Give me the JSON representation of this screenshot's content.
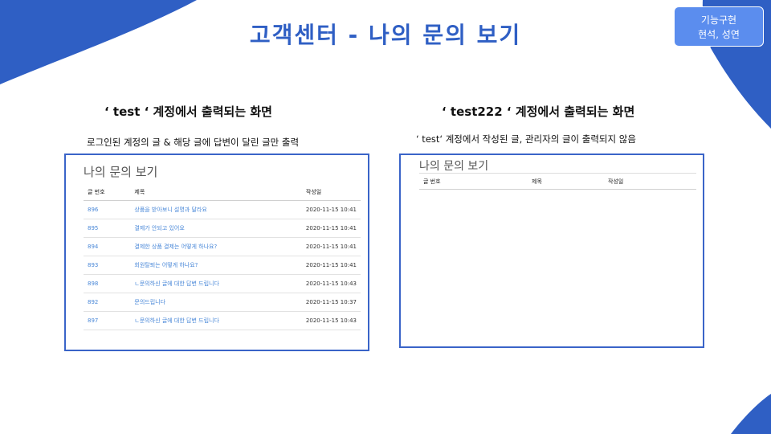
{
  "slide": {
    "title": "고객센터 - 나의 문의 보기",
    "badge": {
      "line1": "기능구현",
      "line2": "현석, 성연"
    },
    "colors": {
      "accent": "#2f5fc4",
      "badge_bg": "#5b8dee",
      "link": "#4a88d8"
    }
  },
  "left": {
    "heading": "‘ test ‘ 계정에서 출력되는 화면",
    "description": "로그인된 계정의 글 &  해당 글에 답변이 달린 글만 출력",
    "panel_title": "나의 문의 보기",
    "columns": [
      "글 번호",
      "제목",
      "작성일"
    ],
    "rows": [
      {
        "no": "896",
        "title": "상품을 받아보니 설명과 달라요",
        "date": "2020-11-15 10:41"
      },
      {
        "no": "895",
        "title": "결제가 안되고 있어요",
        "date": "2020-11-15 10:41"
      },
      {
        "no": "894",
        "title": "결제한 상품 결제는 어떻게 하나요?",
        "date": "2020-11-15 10:41"
      },
      {
        "no": "893",
        "title": "회원탈퇴는 어떻게 하나요?",
        "date": "2020-11-15 10:41"
      },
      {
        "no": "898",
        "title": " ㄴ문의하신 글에 대한 답변 드립니다",
        "date": "2020-11-15 10:43"
      },
      {
        "no": "892",
        "title": "문의드립니다",
        "date": "2020-11-15 10:37"
      },
      {
        "no": "897",
        "title": " ㄴ문의하신 글에 대한 답변 드립니다",
        "date": "2020-11-15 10:43"
      }
    ]
  },
  "right": {
    "heading": "‘ test222 ‘ 계정에서 출력되는 화면",
    "description": "‘ test‘ 계정에서 작성된 글, 관리자의 글이 출력되지 않음",
    "panel_title": "나의 문의 보기",
    "columns": [
      "글 번호",
      "제목",
      "작성일"
    ]
  }
}
